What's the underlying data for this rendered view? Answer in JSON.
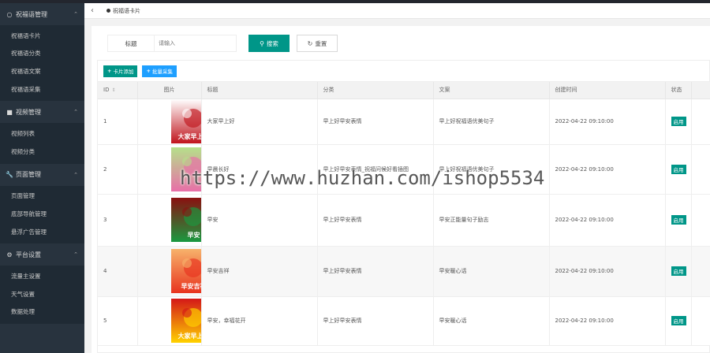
{
  "sidebar": {
    "groups": [
      {
        "icon": "circle-icon",
        "title": "祝福语管理",
        "items": [
          "祝福语卡片",
          "祝福语分类",
          "祝福语文案",
          "祝福语采集"
        ]
      },
      {
        "icon": "video-icon",
        "title": "视频管理",
        "items": [
          "视频列表",
          "视频分类"
        ]
      },
      {
        "icon": "wrench-icon",
        "title": "页面管理",
        "items": [
          "页面管理",
          "底部导航管理",
          "悬浮广告管理"
        ]
      },
      {
        "icon": "gear-icon",
        "title": "平台设置",
        "items": [
          "流量主设置",
          "天气设置",
          "数据处理"
        ]
      }
    ]
  },
  "tabbar": {
    "active_tab": "祝福语卡片"
  },
  "search": {
    "label": "标题",
    "placeholder": "请输入",
    "search_label": "搜索",
    "reset_label": "重置"
  },
  "toolbar": {
    "add_label": "卡片添加",
    "batch_label": "批量采集"
  },
  "table": {
    "columns": [
      "ID",
      "图片",
      "标题",
      "分类",
      "文案",
      "创建时间",
      "状态"
    ],
    "rows": [
      {
        "id": "1",
        "title": "大家早上好",
        "category": "早上好早安表情",
        "copy": "早上好祝福语优美句子",
        "created": "2022-04-22 09:10:00",
        "status": "启用",
        "thumb_text": "大家早上好",
        "thumb_colors": [
          "#ffffff",
          "#c0141c"
        ]
      },
      {
        "id": "2",
        "title": "早晨长好",
        "category": "早上好早安表情_祝福问候好看插图",
        "copy": "早上好祝福语优美句子",
        "created": "2022-04-22 09:10:00",
        "status": "启用",
        "thumb_text": "",
        "thumb_colors": [
          "#b5e08a",
          "#e86fa8"
        ]
      },
      {
        "id": "3",
        "title": "早安",
        "category": "早上好早安表情",
        "copy": "早安正能量句子励志",
        "created": "2022-04-22 09:10:00",
        "status": "启用",
        "thumb_text": "早安",
        "thumb_colors": [
          "#8a1010",
          "#1a9a40"
        ]
      },
      {
        "id": "4",
        "title": "早安吉祥",
        "category": "早上好早安表情",
        "copy": "早安暖心话",
        "created": "2022-04-22 09:10:00",
        "status": "启用",
        "thumb_text": "早安吉祥",
        "thumb_colors": [
          "#f7b26b",
          "#e8331e"
        ]
      },
      {
        "id": "5",
        "title": "早安，幸福花开",
        "category": "早上好早安表情",
        "copy": "早安暖心话",
        "created": "2022-04-22 09:10:00",
        "status": "启用",
        "thumb_text": "大家早上好",
        "thumb_colors": [
          "#d41818",
          "#ffd200"
        ]
      }
    ]
  },
  "watermark": "https://www.huzhan.com/ishop5534"
}
